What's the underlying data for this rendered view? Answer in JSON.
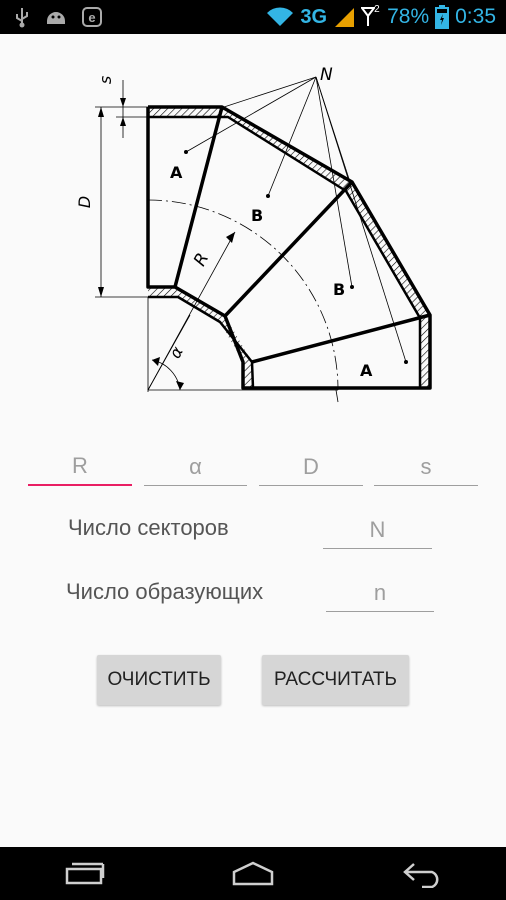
{
  "status_bar": {
    "network": "3G",
    "battery": "78%",
    "time": "0:35",
    "signal_badge": "2",
    "icons": [
      "usb-icon",
      "android-icon",
      "e-icon",
      "wifi-icon",
      "signal-icon",
      "battery-icon"
    ]
  },
  "diagram": {
    "labels": {
      "s": "s",
      "D": "D",
      "N": "N",
      "R": "R",
      "alpha": "α",
      "A_top": "A",
      "B_top": "B",
      "B_bottom": "B",
      "A_bottom": "A"
    }
  },
  "inputs": {
    "R": {
      "placeholder": "R",
      "value": ""
    },
    "alpha": {
      "placeholder": "α",
      "value": ""
    },
    "D": {
      "placeholder": "D",
      "value": ""
    },
    "s": {
      "placeholder": "s",
      "value": ""
    }
  },
  "sectors": {
    "label": "Число секторов",
    "placeholder": "N"
  },
  "generators": {
    "label": "Число образующих",
    "placeholder": "n"
  },
  "buttons": {
    "clear": "ОЧИСТИТЬ",
    "calculate": "РАССЧИТАТЬ"
  },
  "colors": {
    "accent": "#e91e63",
    "status_text": "#33b5e5",
    "button_bg": "#d6d6d6"
  }
}
